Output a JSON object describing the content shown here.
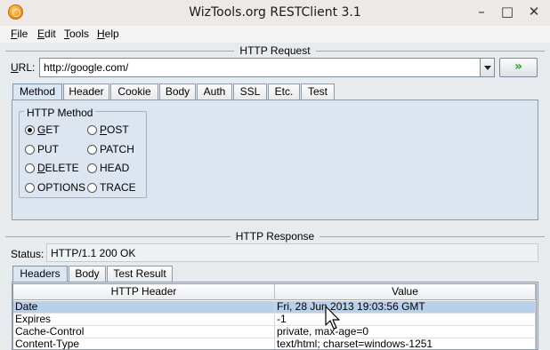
{
  "window": {
    "title": "WizTools.org RESTClient 3.1"
  },
  "menu": [
    "File",
    "Edit",
    "Tools",
    "Help"
  ],
  "request": {
    "section_title": "HTTP Request",
    "url_label": "URL:",
    "url_value": "http://google.com/",
    "go_label": "»",
    "tabs": [
      "Method",
      "Header",
      "Cookie",
      "Body",
      "Auth",
      "SSL",
      "Etc.",
      "Test"
    ],
    "active_tab": "Method",
    "method_group_title": "HTTP Method",
    "methods_left": [
      "GET",
      "PUT",
      "DELETE",
      "OPTIONS"
    ],
    "methods_right": [
      "POST",
      "PATCH",
      "HEAD",
      "TRACE"
    ],
    "selected_method": "GET"
  },
  "response": {
    "section_title": "HTTP Response",
    "status_label": "Status:",
    "status_value": "HTTP/1.1 200 OK",
    "tabs": [
      "Headers",
      "Body",
      "Test Result"
    ],
    "active_tab": "Headers",
    "table": {
      "columns": [
        "HTTP Header",
        "Value"
      ],
      "rows": [
        [
          "Date",
          "Fri, 28 Jun 2013 19:03:56 GMT"
        ],
        [
          "Expires",
          "-1"
        ],
        [
          "Cache-Control",
          "private, max-age=0"
        ],
        [
          "Content-Type",
          "text/html; charset=windows-1251"
        ]
      ],
      "selected_row": 0
    }
  },
  "icons": {
    "app": "app-logo-icon",
    "go": "double-chevron-right-icon",
    "dropdown": "chevron-down-icon",
    "cursor": "mouse-pointer-icon"
  },
  "colors": {
    "go_arrow": "#1ea21e",
    "selected_row": "#b7cfe8",
    "tab_panel": "#dde6f0"
  }
}
